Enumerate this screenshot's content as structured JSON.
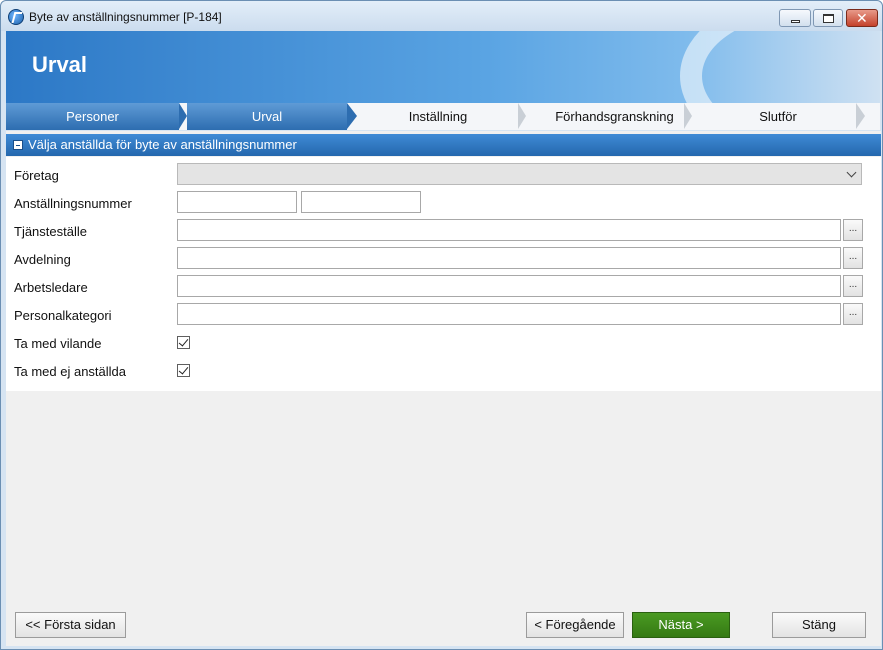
{
  "window": {
    "title": "Byte av anställningsnummer [P-184]"
  },
  "banner": {
    "title": "Urval"
  },
  "wizard": {
    "steps": [
      {
        "label": "Personer",
        "state": "done"
      },
      {
        "label": "Urval",
        "state": "active"
      },
      {
        "label": "Inställning",
        "state": "pending"
      },
      {
        "label": "Förhandsgranskning",
        "state": "pending"
      },
      {
        "label": "Slutför",
        "state": "pending"
      }
    ]
  },
  "section": {
    "title": "Välja anställda för byte av anställningsnummer"
  },
  "form": {
    "company_label": "Företag",
    "company_value": "",
    "employee_number_label": "Anställningsnummer",
    "employee_number_from": "",
    "employee_number_to": "",
    "workplace_label": "Tjänsteställe",
    "workplace_value": "",
    "department_label": "Avdelning",
    "department_value": "",
    "supervisor_label": "Arbetsledare",
    "supervisor_value": "",
    "staff_category_label": "Personalkategori",
    "staff_category_value": "",
    "browse_label": "...",
    "include_inactive_label": "Ta med vilande",
    "include_inactive_checked": true,
    "include_non_employed_label": "Ta med ej anställda",
    "include_non_employed_checked": true
  },
  "footer": {
    "first_page_label": "<< Första sidan",
    "previous_label": "< Föregående",
    "next_label": "Nästa >",
    "close_label": "Stäng"
  },
  "colors": {
    "accent": "#2d6db0",
    "primary_button": "#357a14"
  }
}
